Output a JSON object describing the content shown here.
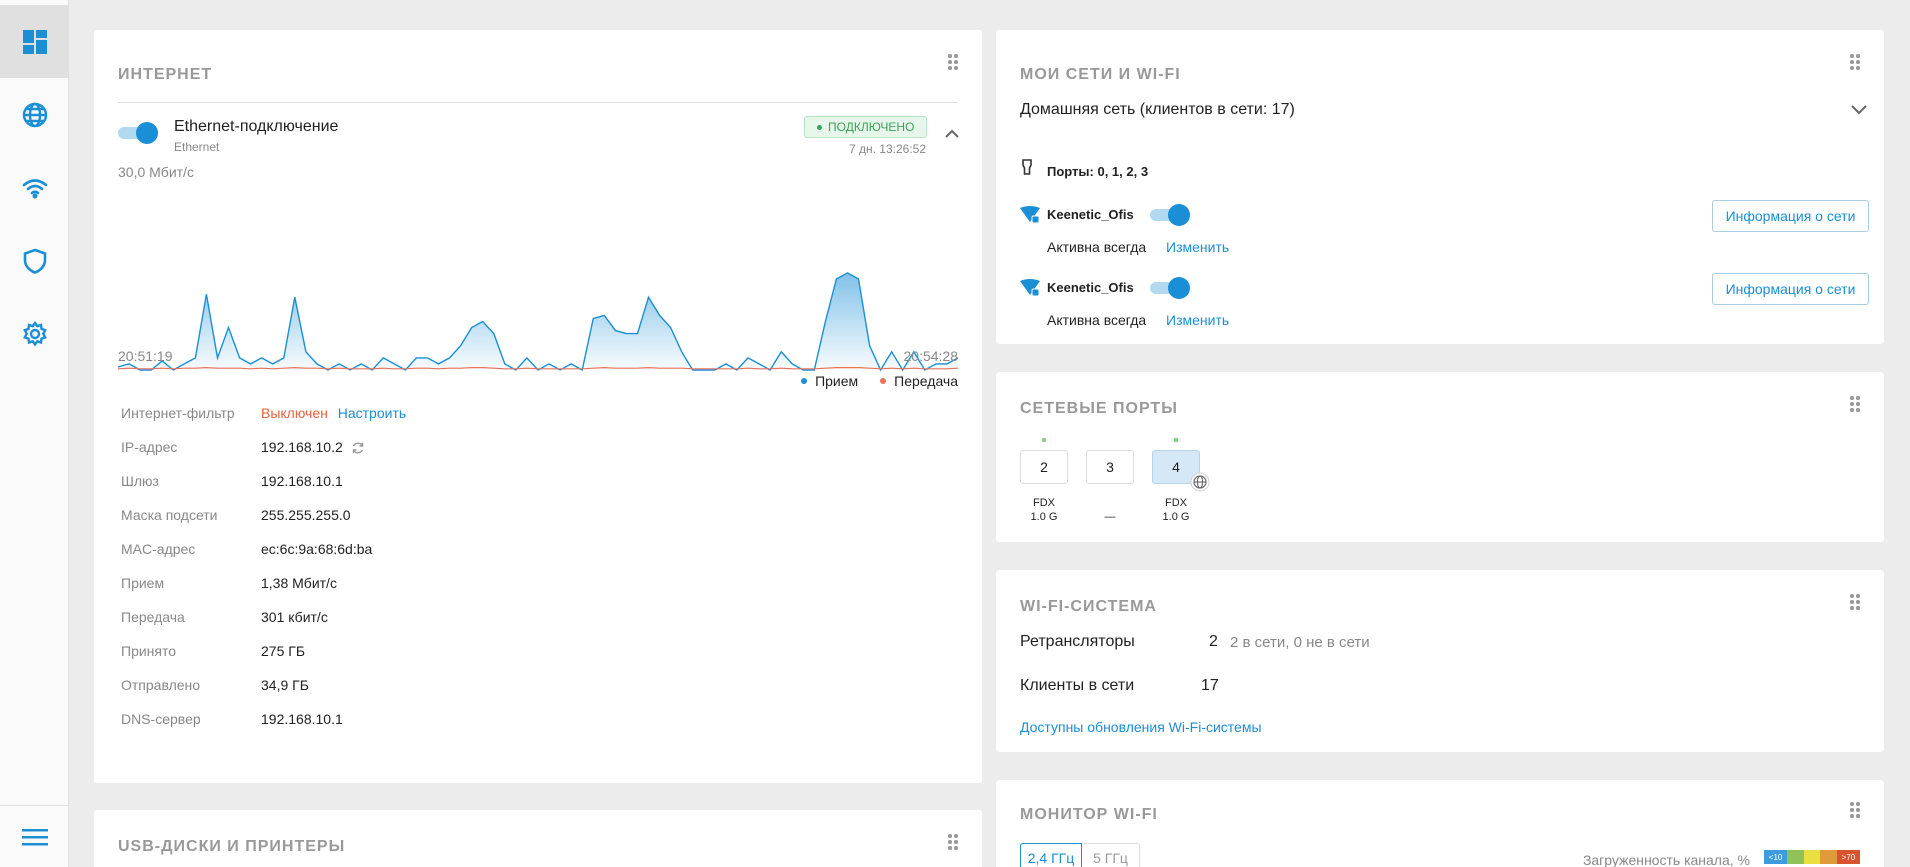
{
  "sidebar": {
    "items": [
      {
        "icon": "dashboard-icon",
        "active": true
      },
      {
        "icon": "globe-icon"
      },
      {
        "icon": "wifi-icon"
      },
      {
        "icon": "shield-icon"
      },
      {
        "icon": "gear-icon"
      }
    ],
    "menu_icon": "hamburger-menu-icon"
  },
  "internet": {
    "title": "ИНТЕРНЕТ",
    "connection_name": "Ethernet-подключение",
    "connection_type": "Ethernet",
    "status": "ПОДКЛЮЧЕНО",
    "uptime": "7 дн. 13:26:52",
    "chart_max_label": "30,0 Мбит/с",
    "time_start": "20:51:19",
    "time_end": "20:54:28",
    "legend_rx": "Прием",
    "legend_tx": "Передача",
    "filter_label": "Интернет-фильтр",
    "filter_value": "Выключен",
    "filter_link": "Настроить",
    "rows": [
      {
        "label": "IP-адрес",
        "value": "192.168.10.2"
      },
      {
        "label": "Шлюз",
        "value": "192.168.10.1"
      },
      {
        "label": "Маска подсети",
        "value": "255.255.255.0"
      },
      {
        "label": "MAC-адрес",
        "value": "ec:6c:9a:68:6d:ba"
      },
      {
        "label": "Прием",
        "value": "1,38 Мбит/с"
      },
      {
        "label": "Передача",
        "value": "301 кбит/с"
      },
      {
        "label": "Принято",
        "value": "275 ГБ"
      },
      {
        "label": "Отправлено",
        "value": "34,9 ГБ"
      },
      {
        "label": "DNS-сервер",
        "value": "192.168.10.1"
      }
    ]
  },
  "chart_data": {
    "type": "area",
    "y_max_label": "30,0 Мбит/с",
    "ylim": [
      0,
      30
    ],
    "x_start": "20:51:19",
    "x_end": "20:54:28",
    "series": [
      {
        "name": "Прием",
        "color": "#1a8fd6",
        "values": [
          0.5,
          1,
          0,
          0,
          1.5,
          0,
          1,
          2,
          12.5,
          2,
          7,
          2,
          1,
          2,
          1,
          2,
          12,
          3,
          1,
          0,
          1,
          0,
          1,
          0,
          2,
          1,
          0,
          2,
          2,
          1,
          2,
          4,
          7,
          8,
          6,
          1,
          0,
          2,
          0,
          1,
          0,
          1,
          0,
          8.5,
          9,
          6.5,
          6,
          6,
          12,
          9,
          7,
          3,
          0,
          0,
          0,
          1,
          0,
          2,
          1,
          0,
          3,
          1,
          0,
          0,
          8,
          15,
          16,
          15,
          4,
          0,
          3,
          0,
          3,
          0,
          1,
          1,
          2
        ]
      },
      {
        "name": "Передача",
        "color": "#e8725a",
        "values": [
          0.2,
          0.3,
          0.2,
          0.2,
          0.3,
          0.2,
          0.3,
          0.3,
          0.4,
          0.3,
          0.3,
          0.3,
          0.2,
          0.3,
          0.2,
          0.3,
          0.4,
          0.3,
          0.3,
          0.2,
          0.3,
          0.2,
          0.2,
          0.2,
          0.3,
          0.2,
          0.2,
          0.3,
          0.3,
          0.2,
          0.3,
          0.3,
          0.4,
          0.4,
          0.3,
          0.2,
          0.2,
          0.3,
          0.2,
          0.2,
          0.2,
          0.2,
          0.2,
          0.3,
          0.4,
          0.3,
          0.3,
          0.3,
          0.4,
          0.3,
          0.3,
          0.3,
          0.2,
          0.2,
          0.2,
          0.2,
          0.2,
          0.3,
          0.2,
          0.2,
          0.3,
          0.2,
          0.2,
          0.2,
          0.3,
          0.4,
          0.4,
          0.4,
          0.3,
          0.2,
          0.3,
          0.2,
          0.3,
          0.2,
          0.2,
          0.2,
          0.3
        ]
      }
    ]
  },
  "usb": {
    "title": "USB-ДИСКИ И ПРИНТЕРЫ"
  },
  "networks": {
    "title": "МОИ СЕТИ И WI-FI",
    "home_network": "Домашняя сеть (клиентов в сети: 17)",
    "ports": "Порты: 0, 1, 2, 3",
    "wifi": [
      {
        "ssid": "Keenetic_Ofis",
        "active": "Активна всегда",
        "change": "Изменить",
        "info_button": "Информация о сети"
      },
      {
        "ssid": "Keenetic_Ofis",
        "active": "Активна всегда",
        "change": "Изменить",
        "info_button": "Информация о сети"
      }
    ]
  },
  "net_ports": {
    "title": "СЕТЕВЫЕ ПОРТЫ",
    "ports": [
      {
        "num": "2",
        "line1": "FDX",
        "line2": "1.0 G",
        "up": false,
        "link_light": true
      },
      {
        "num": "3",
        "line1": "",
        "line2": "—",
        "up": false,
        "link_light": false
      },
      {
        "num": "4",
        "line1": "FDX",
        "line2": "1.0 G",
        "up": true,
        "link_light": true
      }
    ]
  },
  "wifi_system": {
    "title": "WI-FI-СИСТЕМА",
    "repeaters_label": "Ретрансляторы",
    "repeaters_value": "2",
    "repeaters_detail": "2 в сети, 0 не в сети",
    "clients_label": "Клиенты в сети",
    "clients_value": "17",
    "update_link": "Доступны обновления Wi-Fi-системы"
  },
  "wifi_monitor": {
    "title": "МОНИТОР WI-FI",
    "tab_24": "2,4 ГГц",
    "tab_5": "5 ГГц",
    "load_label": "Загруженность канала, %",
    "scale_low": "<10",
    "scale_high": ">70",
    "scale_colors": [
      "#3d9be0",
      "#8fc35a",
      "#e8e040",
      "#e09a3a",
      "#d9542e"
    ]
  }
}
